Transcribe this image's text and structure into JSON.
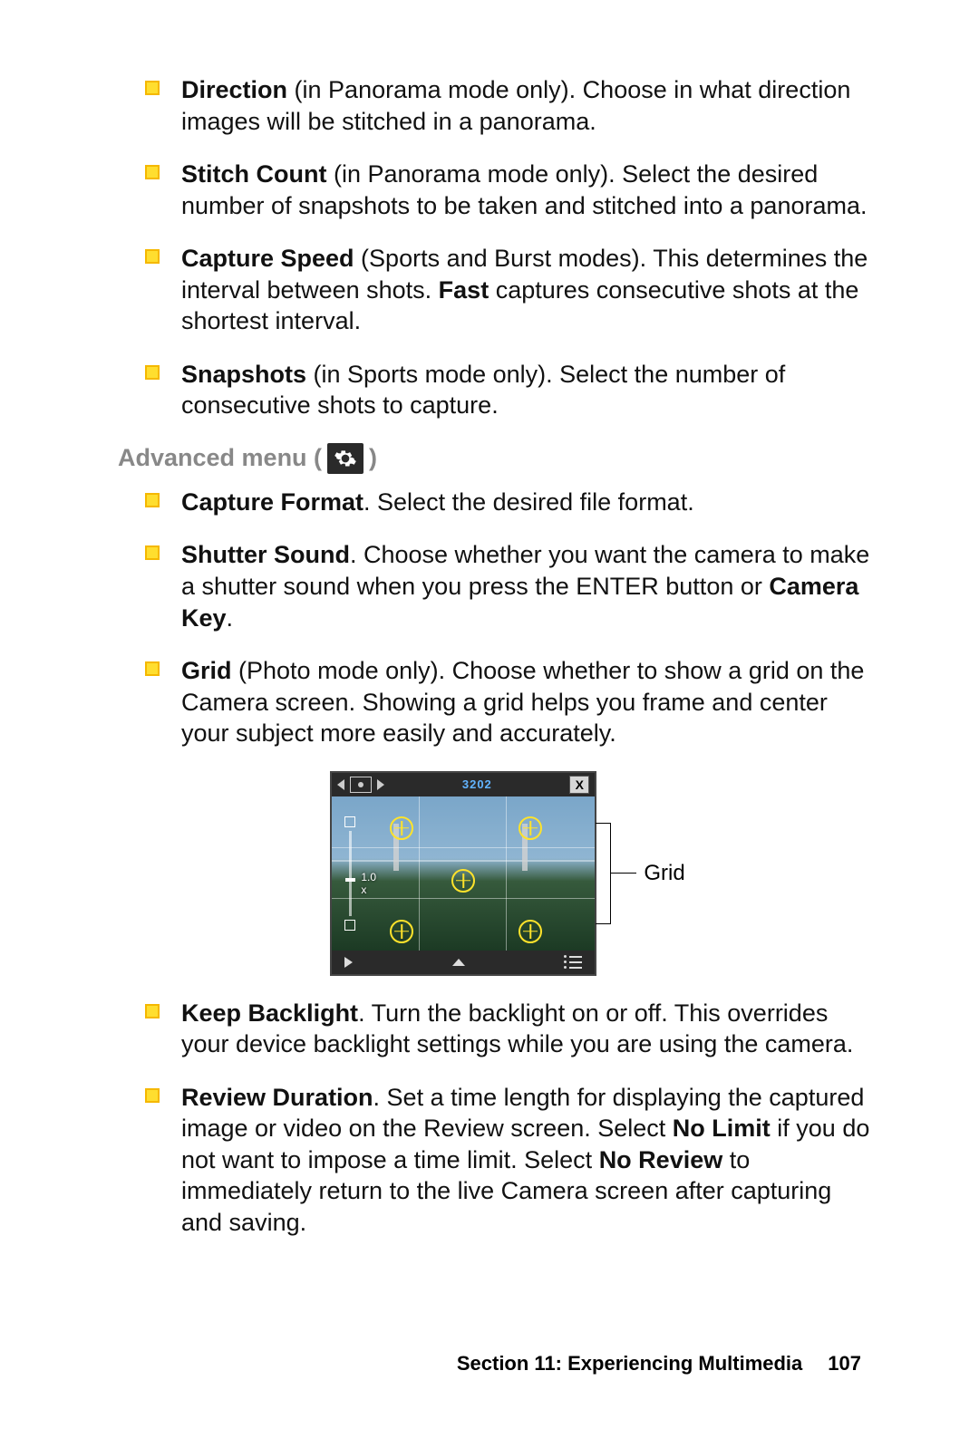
{
  "bullets_top": [
    {
      "bold": "Direction",
      "rest": " (in Panorama mode only). Choose in what direction images will be stitched in a panorama."
    },
    {
      "bold": "Stitch Count",
      "rest": " (in Panorama mode only). Select the desired number of snapshots to be taken and stitched into a panorama."
    },
    {
      "html": "<b>Capture Speed</b> (Sports and Burst modes). This determines the interval between shots. <b>Fast</b> captures consecutive shots at the shortest interval."
    },
    {
      "bold": "Snapshots",
      "rest": " (in Sports mode only). Select the number of consecutive shots to capture."
    }
  ],
  "section": {
    "prefix": "Advanced menu (",
    "suffix": ")"
  },
  "bullets_adv": [
    {
      "html": "<b>Capture Format</b>. Select the desired file format."
    },
    {
      "html": "<b>Shutter Sound</b>. Choose whether you want the camera to make a shutter sound when you press the ENTER button or <b>Camera Key</b>."
    },
    {
      "html": "<b>Grid</b> (Photo mode only). Choose whether to show a grid on the Camera screen. Showing a grid helps you frame and center your subject more easily and accurately."
    }
  ],
  "figure": {
    "counter": "3202",
    "zoom": "1.0 x",
    "close": "X",
    "callout": "Grid"
  },
  "bullets_after": [
    {
      "html": "<b>Keep Backlight</b>. Turn the backlight on or off. This overrides your device backlight settings while you are using the camera."
    },
    {
      "html": "<b>Review Duration</b>. Set a time length for displaying the captured image or video on the Review screen. Select <b>No Limit</b> if you do not want to impose a time limit. Select <b>No Review</b> to immediately return to the live Camera screen after capturing and saving."
    }
  ],
  "footer": {
    "section": "Section 11: Experiencing Multimedia",
    "page": "107"
  }
}
